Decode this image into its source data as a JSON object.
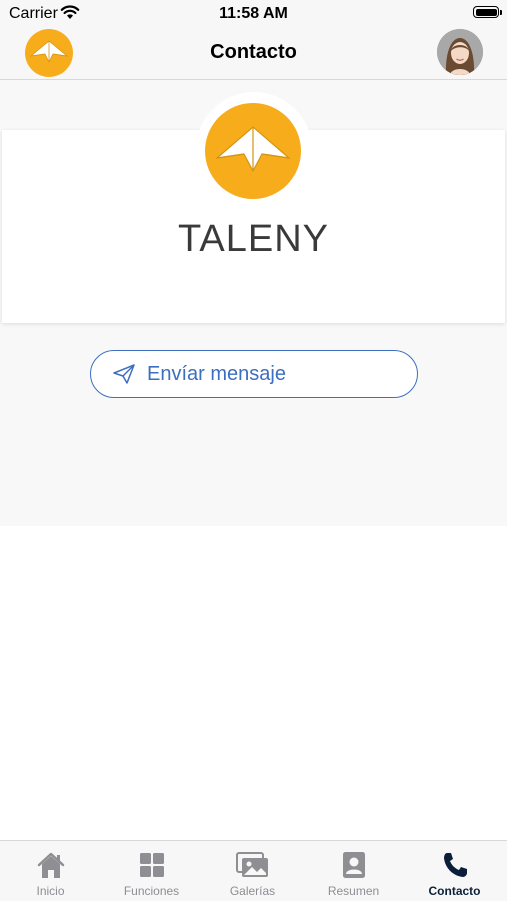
{
  "status_bar": {
    "carrier": "Carrier",
    "time": "11:58 AM"
  },
  "nav": {
    "title": "Contacto"
  },
  "profile": {
    "company_name": "TALENY"
  },
  "actions": {
    "send_message_label": "Envíar mensaje"
  },
  "tabs": [
    {
      "label": "Inicio",
      "icon": "home-icon"
    },
    {
      "label": "Funciones",
      "icon": "grid-icon"
    },
    {
      "label": "Galerías",
      "icon": "gallery-icon"
    },
    {
      "label": "Resumen",
      "icon": "contact-card-icon"
    },
    {
      "label": "Contacto",
      "icon": "phone-icon",
      "active": true
    }
  ],
  "colors": {
    "brand_orange": "#f7ad1b",
    "accent_blue": "#3c6fc0",
    "active_tab": "#0b1f3a",
    "inactive_tab": "#8e8e93"
  }
}
